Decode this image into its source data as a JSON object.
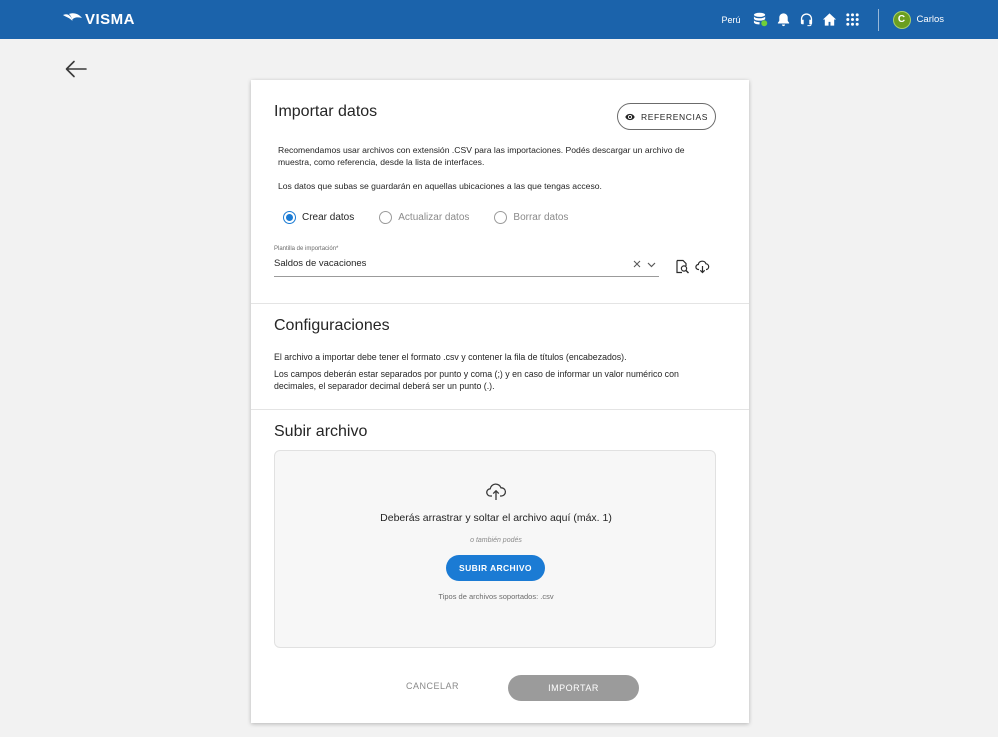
{
  "topbar": {
    "brand": "VISMA",
    "country": "Perú",
    "user_initial": "C",
    "user_name": "Carlos",
    "icons": [
      "database-icon",
      "bell-icon",
      "headset-icon",
      "home-icon",
      "apps-grid-icon"
    ],
    "bg_color": "#1b63ab"
  },
  "nav": {
    "back_icon": "arrow-left-icon"
  },
  "import": {
    "title": "Importar datos",
    "references_label": "REFERENCIAS",
    "intro_line1": "Recomendamos usar archivos con extensión .CSV para las importaciones. Podés descargar un archivo de",
    "intro_line2": "muestra, como referencia, desde la lista de interfaces.",
    "access_note": "Los datos que subas se guardarán en aquellas ubicaciones a las que tengas acceso.",
    "radio_options": [
      {
        "label": "Crear datos",
        "checked": true
      },
      {
        "label": "Actualizar datos",
        "checked": false
      },
      {
        "label": "Borrar datos",
        "checked": false
      }
    ],
    "template_label": "Plantilla de importación*",
    "template_value": "Saldos de vacaciones"
  },
  "config": {
    "title": "Configuraciones",
    "line1": "El archivo a importar debe tener el formato .csv y contener la fila de títulos (encabezados).",
    "line2": "Los campos deberán estar separados por punto y coma (;) y en caso de informar un valor numérico con",
    "line3": "decimales, el separador decimal deberá ser un punto (.)."
  },
  "upload": {
    "title": "Subir archivo",
    "drop_text": "Deberás arrastrar y soltar el archivo aquí (máx. 1)",
    "or_text": "o también podés",
    "button_label": "SUBIR ARCHIVO",
    "types_text": "Tipos de archivos soportados: .csv"
  },
  "actions": {
    "cancel_label": "CANCELAR",
    "import_label": "IMPORTAR"
  },
  "colors": {
    "accent": "#1b7bd4",
    "disabled": "#9b9b9b"
  }
}
